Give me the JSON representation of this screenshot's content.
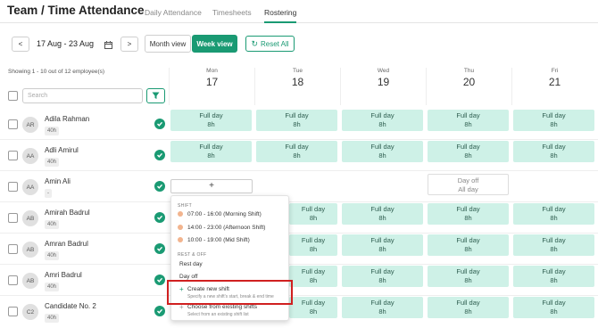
{
  "header": {
    "title": "Team  /  Time Attendance",
    "tabs": [
      "Daily Attendance",
      "Timesheets",
      "Rostering"
    ]
  },
  "toolbar": {
    "prev": "<",
    "next": ">",
    "date_range": "17 Aug - 23 Aug",
    "month_view": "Month view",
    "week_view": "Week view",
    "reset_all": "Reset All"
  },
  "sidebar": {
    "showing": "Showing 1 - 10 out of 12 employee(s)",
    "search_placeholder": "Search"
  },
  "days": [
    {
      "name": "Mon",
      "num": "17"
    },
    {
      "name": "Tue",
      "num": "18"
    },
    {
      "name": "Wed",
      "num": "19"
    },
    {
      "name": "Thu",
      "num": "20"
    },
    {
      "name": "Fri",
      "num": "21"
    }
  ],
  "employees": [
    {
      "initials": "AR",
      "name": "Adila Rahman",
      "hours": "40h"
    },
    {
      "initials": "AA",
      "name": "Adli Amirul",
      "hours": "40h"
    },
    {
      "initials": "AA",
      "name": "Amin Ali",
      "hours": "-"
    },
    {
      "initials": "AB",
      "name": "Amirah Badrul",
      "hours": "40h"
    },
    {
      "initials": "AB",
      "name": "Amran Badrul",
      "hours": "40h"
    },
    {
      "initials": "AB",
      "name": "Amri Badrul",
      "hours": "40h"
    },
    {
      "initials": "C2",
      "name": "Candidate No. 2",
      "hours": "40h"
    }
  ],
  "shift": {
    "line1": "Full day",
    "line2": "8h"
  },
  "dayoff": {
    "line1": "Day off",
    "line2": "All day"
  },
  "add_label": "+",
  "menu": {
    "shift_header": "SHIFT",
    "shifts": [
      "07:00 - 16:00 (Morning Shift)",
      "14:00 - 23:00 (Afternoon Shift)",
      "10:00 - 19:00 (Mid Shift)"
    ],
    "rest_header": "REST & OFF",
    "rest_day": "Rest day",
    "day_off": "Day off",
    "create_title": "Create new shift",
    "create_sub": "Specify a new shift's start, break & end time",
    "choose_title": "Choose from existing shifts",
    "choose_sub": "Select from an existing shift list"
  },
  "colors": {
    "accent": "#1a9a73",
    "shift_bg": "#cef1e7",
    "highlight": "#d02020"
  }
}
